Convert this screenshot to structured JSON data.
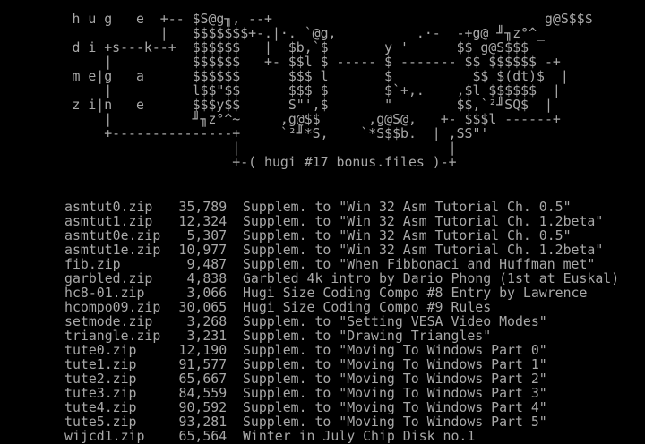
{
  "screen": {
    "ascii_art_lines": [
      "         h u g   e  +-- $S@g╖, --+                                  g@S$$$",
      "                    |   $$$$$$$+-.|·. `@g,          .·-  -+g@ ╜╖z°^_",
      "         d i +s---k--+  $$$$$$   |  $b,`$       y '      $$ g@S$$$",
      "             |          $$$$$$   +- $$l $ ----- $ ------- $$ $$$$$$ -+",
      "         m e|g   a      $$$$$$      $$$ l       $          $$ $(dt)$  |",
      "             |          l$$\"$$      $$$ $       $`+,._  _,$l $$$$$$  |",
      "         z i|n   e      $$$y$$      S\"',$       \"        $$,`²╜SQ$  |",
      "             |          ╜╖z°^~     ,g@$$      ,g@S@,   +- $$$l ------+",
      "             +---------------+     `²╜*S,_  _`*S$$b._ | ,SS\"'",
      "                             |                          |",
      "                             +-( hugi #17 bonus.files )-+"
    ],
    "files": [
      {
        "name": "asmtut0.zip",
        "size": "35,789",
        "desc": "Supplem. to \"Win 32 Asm Tutorial Ch. 0.5\""
      },
      {
        "name": "asmtut1.zip",
        "size": "12,324",
        "desc": "Supplem. to \"Win 32 Asm Tutorial Ch. 1.2beta\""
      },
      {
        "name": "asmtut0e.zip",
        "size": "5,307",
        "desc": "Supplem. to \"Win 32 Asm Tutorial Ch. 0.5\""
      },
      {
        "name": "asmtut1e.zip",
        "size": "10,977",
        "desc": "Supplem. to \"Win 32 Asm Tutorial Ch. 1.2beta\""
      },
      {
        "name": "fib.zip",
        "size": "9,487",
        "desc": "Supplem. to \"When Fibbonaci and Huffman met\""
      },
      {
        "name": "garbled.zip",
        "size": "4,838",
        "desc": "Garbled 4k intro by Dario Phong (1st at Euskal)"
      },
      {
        "name": "hc8-01.zip",
        "size": "3,066",
        "desc": "Hugi Size Coding Compo #8 Entry by Lawrence"
      },
      {
        "name": "hcompo09.zip",
        "size": "30,065",
        "desc": "Hugi Size Coding Compo #9 Rules"
      },
      {
        "name": "setmode.zip",
        "size": "3,268",
        "desc": "Supplem. to \"Setting VESA Video Modes\""
      },
      {
        "name": "triangle.zip",
        "size": "3,231",
        "desc": "Supplem. to \"Drawing Triangles\""
      },
      {
        "name": "tute0.zip",
        "size": "12,190",
        "desc": "Supplem. to \"Moving To Windows Part 0\""
      },
      {
        "name": "tute1.zip",
        "size": "91,577",
        "desc": "Supplem. to \"Moving To Windows Part 1\""
      },
      {
        "name": "tute2.zip",
        "size": "65,667",
        "desc": "Supplem. to \"Moving To Windows Part 2\""
      },
      {
        "name": "tute3.zip",
        "size": "84,559",
        "desc": "Supplem. to \"Moving To Windows Part 3\""
      },
      {
        "name": "tute4.zip",
        "size": "90,592",
        "desc": "Supplem. to \"Moving To Windows Part 4\""
      },
      {
        "name": "tute5.zip",
        "size": "93,281",
        "desc": "Supplem. to \"Moving To Windows Part 5\""
      },
      {
        "name": "wijcd1.zip",
        "size": "65,564",
        "desc": "Winter in July Chip Disk no.1"
      }
    ],
    "colors": {
      "background": "#000000",
      "text": "#a8a8a8"
    }
  }
}
